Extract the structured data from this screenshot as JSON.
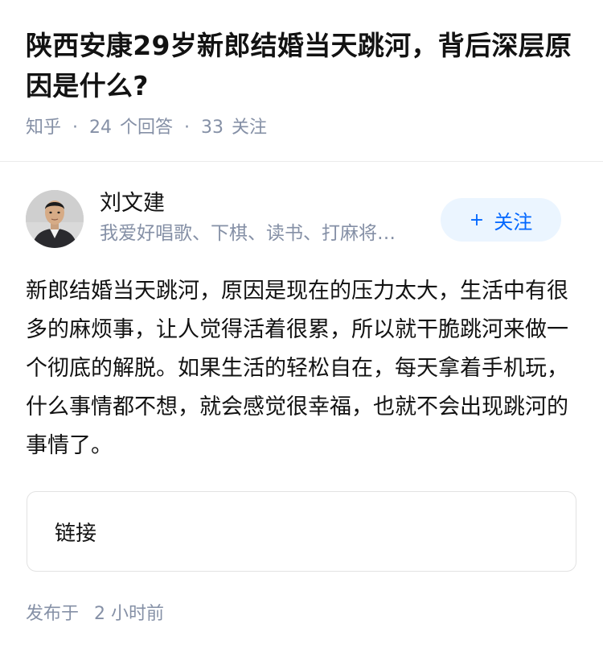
{
  "question": {
    "title": "陕西安康29岁新郎结婚当天跳河，背后深层原因是什么?",
    "source": "知乎",
    "answer_count": "24",
    "answer_label": "个回答",
    "follow_count": "33",
    "follow_label": "关注"
  },
  "author": {
    "name": "刘文建",
    "bio": "我爱好唱歌、下棋、读书、打麻将…",
    "avatar_icon": "person-avatar-icon"
  },
  "follow_button": {
    "plus": "+",
    "label": "关注",
    "color": "#0066ff",
    "background": "#ebf5ff"
  },
  "answer": {
    "content": "新郎结婚当天跳河，原因是现在的压力太大，生活中有很多的麻烦事，让人觉得活着很累，所以就干脆跳河来做一个彻底的解脱。如果生活的轻松自在，每天拿着手机玩，什么事情都不想，就会感觉很幸福，也就不会出现跳河的事情了。"
  },
  "link_card": {
    "label": "链接"
  },
  "footer": {
    "publish_label": "发布于",
    "publish_time": "2 小时前"
  },
  "colors": {
    "text_primary": "#121212",
    "text_secondary": "#8590a6",
    "divider": "#ebebeb"
  }
}
